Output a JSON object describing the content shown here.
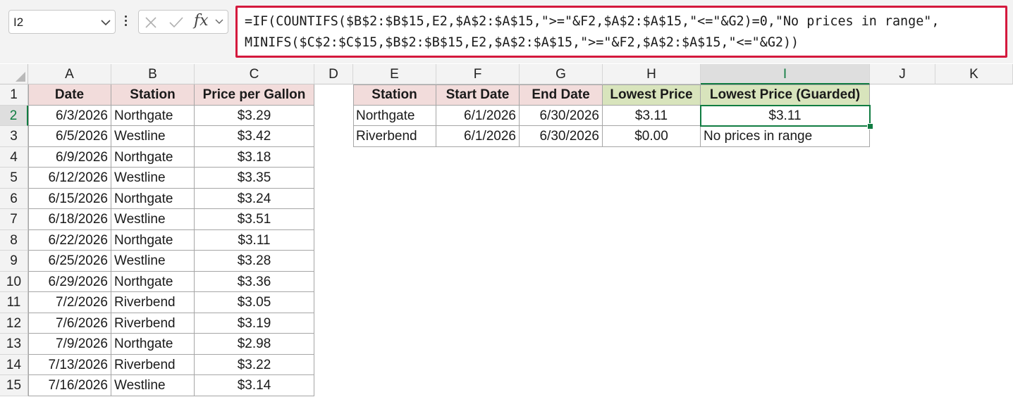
{
  "formula_bar": {
    "name_box": "I2",
    "fx_label": "fx",
    "formula_line1": "=IF(COUNTIFS($B$2:$B$15,E2,$A$2:$A$15,\">=\"&F2,$A$2:$A$15,\"<=\"&G2)=0,\"No prices in range\",",
    "formula_line2": "MINIFS($C$2:$C$15,$B$2:$B$15,E2,$A$2:$A$15,\">=\"&F2,$A$2:$A$15,\"<=\"&G2))"
  },
  "columns": [
    "A",
    "B",
    "C",
    "D",
    "E",
    "F",
    "G",
    "H",
    "I",
    "J",
    "K"
  ],
  "rows": [
    "1",
    "2",
    "3",
    "4",
    "5",
    "6",
    "7",
    "8",
    "9",
    "10",
    "11",
    "12",
    "13",
    "14",
    "15"
  ],
  "selected_cell": {
    "column": "I",
    "row": "2"
  },
  "data_table": {
    "headers": [
      "Date",
      "Station",
      "Price per Gallon"
    ],
    "rows": [
      [
        "6/3/2026",
        "Northgate",
        "$3.29"
      ],
      [
        "6/5/2026",
        "Westline",
        "$3.42"
      ],
      [
        "6/9/2026",
        "Northgate",
        "$3.18"
      ],
      [
        "6/12/2026",
        "Westline",
        "$3.35"
      ],
      [
        "6/15/2026",
        "Northgate",
        "$3.24"
      ],
      [
        "6/18/2026",
        "Westline",
        "$3.51"
      ],
      [
        "6/22/2026",
        "Northgate",
        "$3.11"
      ],
      [
        "6/25/2026",
        "Westline",
        "$3.28"
      ],
      [
        "6/29/2026",
        "Northgate",
        "$3.36"
      ],
      [
        "7/2/2026",
        "Riverbend",
        "$3.05"
      ],
      [
        "7/6/2026",
        "Riverbend",
        "$3.19"
      ],
      [
        "7/9/2026",
        "Northgate",
        "$2.98"
      ],
      [
        "7/13/2026",
        "Riverbend",
        "$3.22"
      ],
      [
        "7/16/2026",
        "Westline",
        "$3.14"
      ]
    ]
  },
  "lookup_table": {
    "headers": [
      "Station",
      "Start Date",
      "End Date",
      "Lowest Price",
      "Lowest Price (Guarded)"
    ],
    "rows": [
      [
        "Northgate",
        "6/1/2026",
        "6/30/2026",
        "$3.11",
        "$3.11"
      ],
      [
        "Riverbend",
        "6/1/2026",
        "6/30/2026",
        "$0.00",
        "No prices in range"
      ]
    ]
  },
  "colors": {
    "formula_highlight": "#d4193d",
    "selection": "#107c41",
    "header_pink": "#f2dcdb",
    "header_green": "#d8e4bc"
  }
}
